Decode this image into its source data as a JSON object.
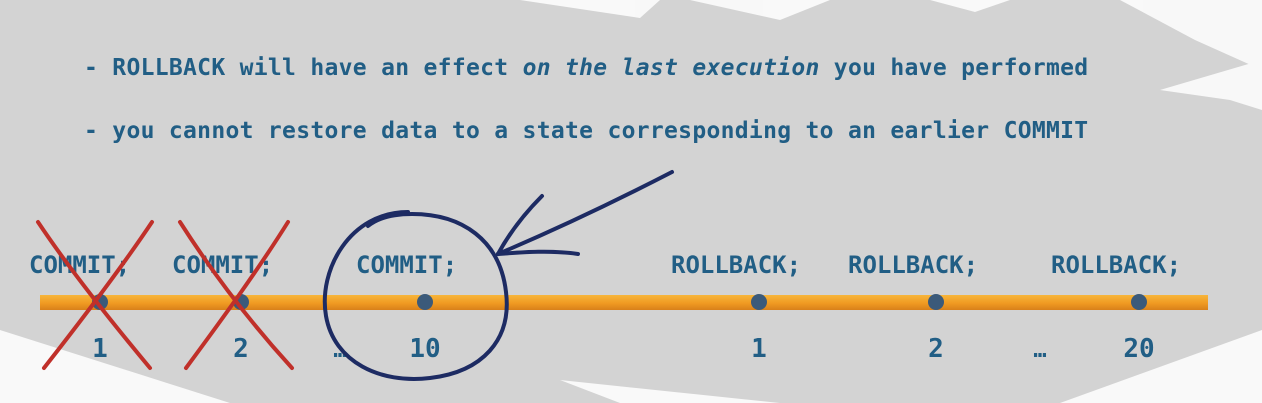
{
  "bullets": {
    "line1_a": "- ROLLBACK will have an effect ",
    "line1_em": "on the last execution",
    "line1_b": " you have performed",
    "line2": "- you cannot restore data to a state corresponding to an earlier COMMIT"
  },
  "timeline": {
    "commit_labels": [
      "COMMIT;",
      "COMMIT;",
      "COMMIT;"
    ],
    "rollback_labels": [
      "ROLLBACK;",
      "ROLLBACK;",
      "ROLLBACK;"
    ],
    "commit_numbers": [
      "1",
      "2",
      "10"
    ],
    "rollback_numbers": [
      "1",
      "2",
      "20"
    ],
    "ellipsis": "…"
  },
  "colors": {
    "text": "#215e85",
    "bar": "#f0a32a",
    "dot": "#3b5a7a",
    "cross": "#c0302a",
    "ink": "#1d2b63"
  }
}
